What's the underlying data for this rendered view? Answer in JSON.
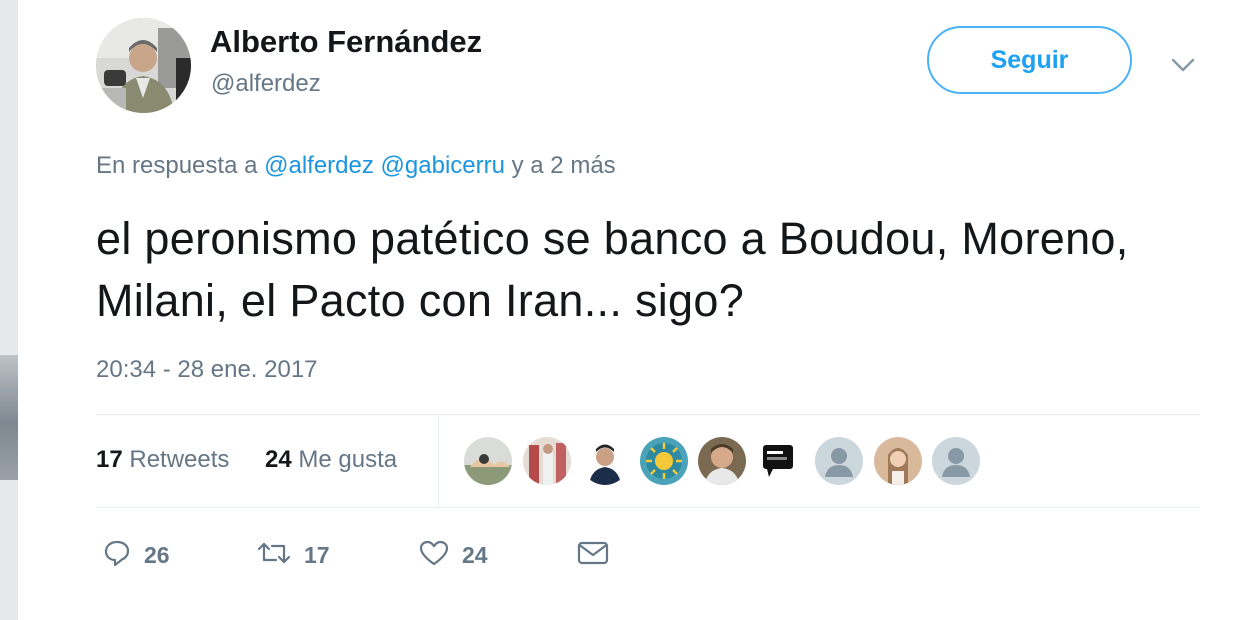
{
  "author": {
    "display_name": "Alberto Fernández",
    "handle": "@alferdez"
  },
  "follow_button": {
    "label": "Seguir"
  },
  "reply": {
    "prefix": "En respuesta a",
    "mentions": [
      "@alferdez",
      "@gabicerru"
    ],
    "suffix": "y a 2 más"
  },
  "tweet": {
    "text": "el peronismo patético se banco a Boudou, Moreno, Milani, el Pacto con Iran... sigo?",
    "timestamp": "20:34 - 28 ene. 2017"
  },
  "stats": {
    "retweets_count": "17",
    "retweets_label": "Retweets",
    "likes_count": "24",
    "likes_label": "Me gusta"
  },
  "actions": {
    "reply_count": "26",
    "retweet_count": "17",
    "like_count": "24"
  },
  "colors": {
    "accent": "#1da1f2",
    "mention": "#1b95e0",
    "muted": "#657786",
    "text": "#14171a"
  },
  "liker_avatars": [
    "landscape",
    "group-photo",
    "man-portrait",
    "sun-logo",
    "man-portrait",
    "graphic-logo",
    "default-avatar",
    "woman-photo",
    "default-avatar"
  ]
}
